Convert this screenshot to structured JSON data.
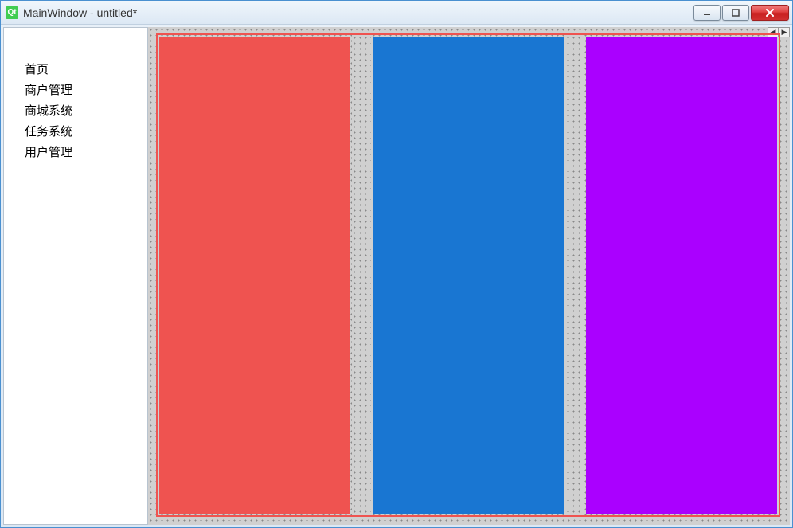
{
  "window": {
    "title": "MainWindow - untitled*"
  },
  "sidebar": {
    "items": [
      {
        "label": "首页"
      },
      {
        "label": "商户管理"
      },
      {
        "label": "商城系统"
      },
      {
        "label": "任务系统"
      },
      {
        "label": "用户管理"
      }
    ]
  },
  "panels": {
    "colors": {
      "red": "#ef5350",
      "blue": "#1976d2",
      "purple": "#aa00ff"
    }
  }
}
